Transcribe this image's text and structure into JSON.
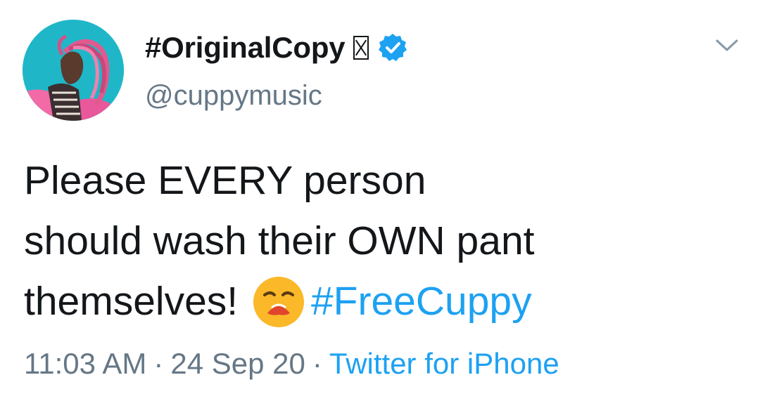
{
  "user": {
    "display_name": "#OriginalCopy",
    "handle": "@cuppymusic",
    "verified": true,
    "avatar_icon": "profile-photo",
    "name_suffix_icon": "unrendered-emoji-icon"
  },
  "tweet": {
    "text_line_1": "Please EVERY person",
    "text_line_2": "should wash their OWN pant",
    "text_line_3": "themselves!",
    "emoji_name": "anguished-face-emoji",
    "hashtag": "#FreeCuppy"
  },
  "meta": {
    "time": "11:03 AM",
    "separator": "·",
    "date": "24 Sep 20",
    "source": "Twitter for iPhone"
  },
  "colors": {
    "link": "#1da1f2",
    "secondary_text": "#657786",
    "primary_text": "#14171a",
    "verified": "#1da1f2",
    "avatar_background": "#1fb7c8"
  },
  "icons": {
    "menu": "chevron-down-icon",
    "verified": "verified-badge-icon"
  }
}
